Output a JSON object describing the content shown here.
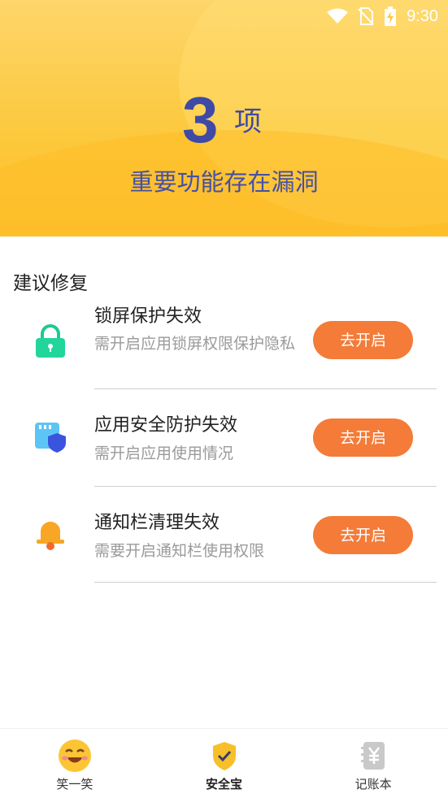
{
  "status": {
    "time": "9:30"
  },
  "hero": {
    "count": "3",
    "unit": "项",
    "subtitle": "重要功能存在漏洞"
  },
  "section": {
    "title": "建议修复"
  },
  "items": [
    {
      "title": "锁屏保护失效",
      "desc": "需开启应用锁屏权限保护隐私",
      "button": "去开启",
      "icon": "lock-icon"
    },
    {
      "title": "应用安全防护失效",
      "desc": "需开启应用使用情况",
      "button": "去开启",
      "icon": "app-shield-icon"
    },
    {
      "title": "通知栏清理失效",
      "desc": "需要开启通知栏使用权限",
      "button": "去开启",
      "icon": "bell-icon"
    }
  ],
  "nav": [
    {
      "label": "笑一笑",
      "icon": "smiley-icon"
    },
    {
      "label": "安全宝",
      "icon": "shield-check-icon",
      "active": true
    },
    {
      "label": "记账本",
      "icon": "ledger-icon"
    }
  ],
  "colors": {
    "accent": "#f47b38",
    "heroText": "#3f4aa6",
    "header": "#fcc83b"
  }
}
